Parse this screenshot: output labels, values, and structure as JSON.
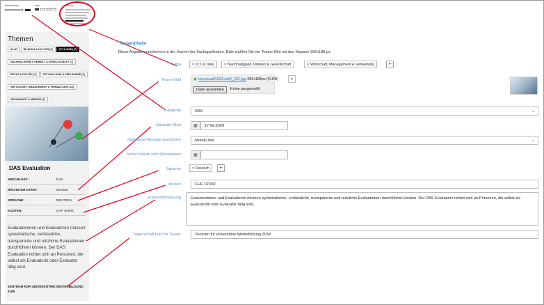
{
  "header_preview": {
    "col1_title": "Weiterbildung",
    "col2_title": "Filter",
    "col3_title": "Themen"
  },
  "left": {
    "themen_title": "Themen",
    "tags": [
      {
        "label": "ALLE",
        "active": false
      },
      {
        "label": "BILDUNG & KULTUR [3]",
        "active": false
      },
      {
        "label": "ICT & DATA [7]",
        "active": true
      },
      {
        "label": "NACHHALTIGKEIT, UMWELT & GESELLSCHAFT [7]",
        "active": false
      },
      {
        "label": "RECHT & POLITIK [1]",
        "active": false
      },
      {
        "label": "PSYCHOLOGIE & SEELSORGE [4]",
        "active": false
      },
      {
        "label": "WIRTSCHAFT, MANAGEMENT & VERWALTUNG [10]",
        "active": false
      },
      {
        "label": "GESUNDHEIT & MEDIZIN [1]",
        "active": false
      }
    ],
    "card": {
      "title": "DAS Evaluation",
      "rows": [
        {
          "k": "ABSCHLUSS:",
          "v": "DAS"
        },
        {
          "k": "NÄCHSTER START:",
          "v": "09.2020"
        },
        {
          "k": "SPRACHE:",
          "v": "DEUTSCH"
        },
        {
          "k": "KOSTEN:",
          "v": "CHF 16'000"
        }
      ],
      "description": "Evaluatorinnen und Evaluatoren müssen systematische, verlässliche, transparente und nützliche Evaluationen durchführen können. Der DAS Evaluation richtet sich an Personen, die selbst als Evaluatorin oder Evaluator tätig sind.",
      "traeger": "ZENTRUM FÜR UNIVERSITÄRE WEITERBILDUNG ZUW"
    }
  },
  "form": {
    "section_title": "Teaserinhalte",
    "section_desc": "Diese Angaben erscheinen in der Kachel der Suchapplikation. Bitte wählen Sie ein Teaser-Bild mit den Massen 282x188 px.",
    "labels": {
      "thema": "Thema",
      "teaser_bild": "Teaser-Bild",
      "kategorie": "Kategorie",
      "naechster_start": "Nächster Start",
      "startdatum_anzeige": "Startdatum Anzeige auswählen",
      "sorter_datum": "Sorter-Datum zum Übersteuern",
      "sprache": "Sprache",
      "kosten": "Kosten",
      "zusammenfassung": "Zusammenfassung",
      "traegerschaft": "Trägerschaft kurz für Teaser"
    },
    "thema_chips": [
      "ICT & Data",
      "Nachhaltigkeit, Umwelt & Gesellschaft",
      "Wirtschaft, Management & Verwaltung"
    ],
    "file": {
      "name": "keyvisualDASEvali4_282.jpg",
      "meta": "282x188px (51KB)",
      "button": "Datei auswählen",
      "none": "Keine ausgewählt"
    },
    "kategorie_value": "DAS",
    "naechster_start_value": "17.09.2020",
    "startdatum_value": "Monat/Jahr",
    "sorter_value": "",
    "sprache_chips": [
      "Deutsch"
    ],
    "kosten_value": "CHF 16'000",
    "zusammenfassung_value": "Evaluatorinnen und Evaluatoren müssen systematische, verlässliche, transparente und nützliche Evaluationen durchführen können. Der DAS Evaluation richtet sich an Personen, die selbst als Evaluatorin oder Evaluator tätig sind.",
    "traegerschaft_value": "Zentrum für universitäre Weiterbildung ZUW"
  },
  "colors": {
    "annotation": "#e0001a",
    "label_blue": "#5b8fc7",
    "link_blue": "#2b7ec1"
  }
}
